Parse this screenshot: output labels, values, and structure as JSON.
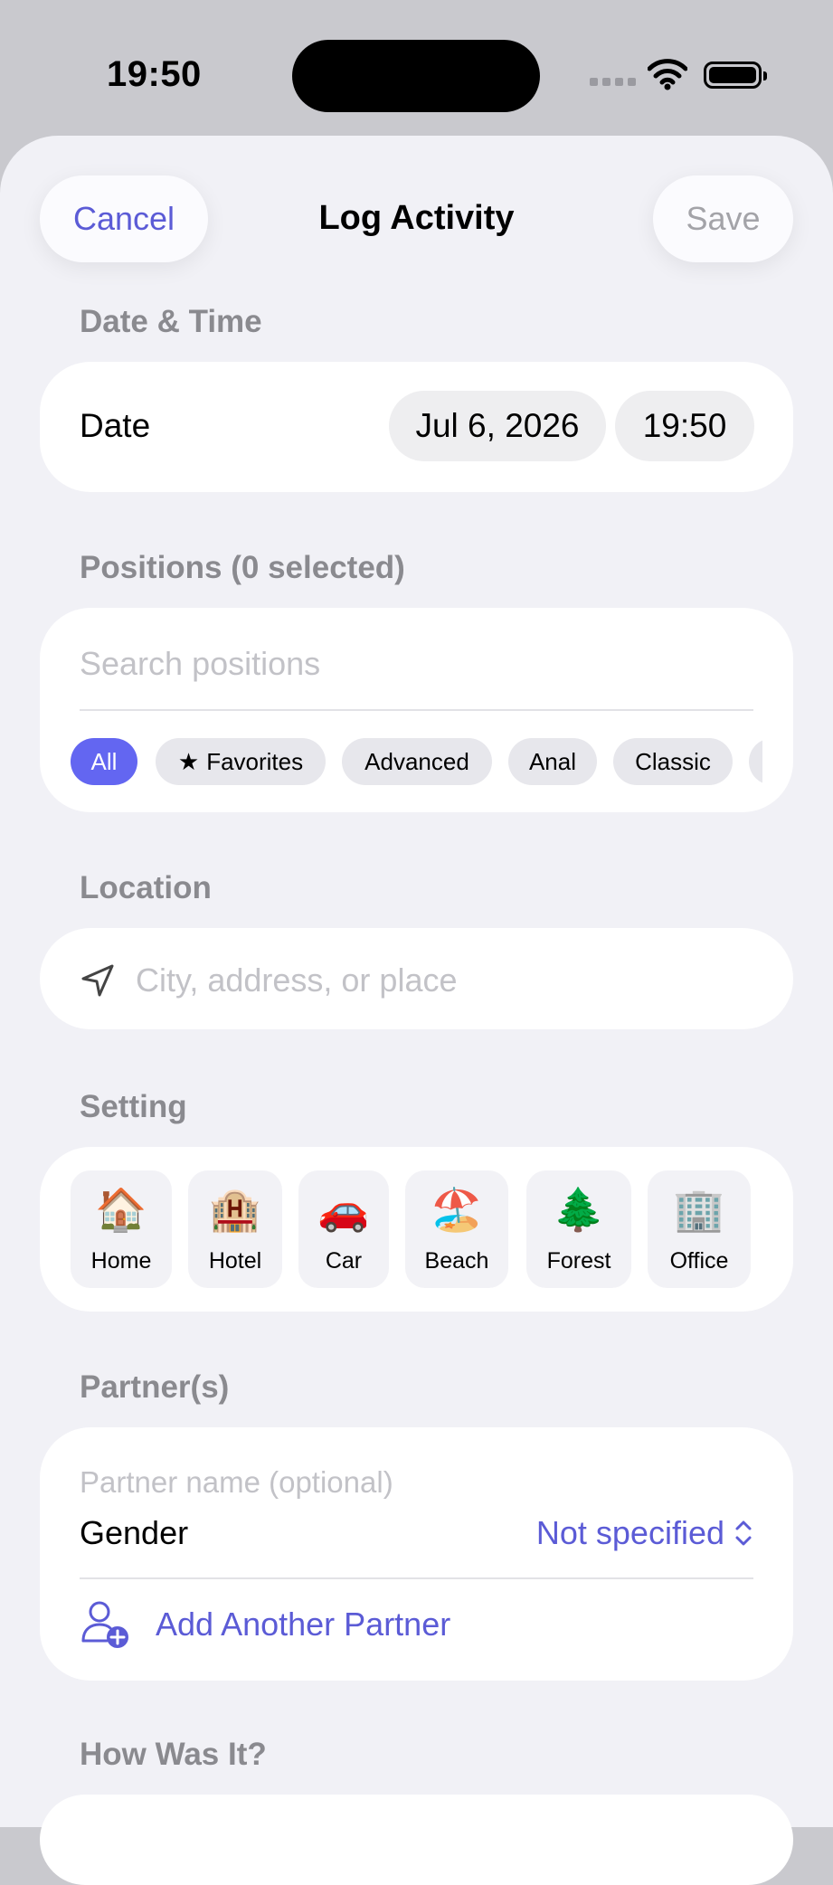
{
  "status_bar": {
    "time": "19:50"
  },
  "nav": {
    "cancel": "Cancel",
    "title": "Log Activity",
    "save": "Save"
  },
  "date_time": {
    "header": "Date & Time",
    "label": "Date",
    "date": "Jul 6, 2026",
    "time": "19:50"
  },
  "positions": {
    "header": "Positions (0 selected)",
    "search_placeholder": "Search positions",
    "chips": [
      {
        "label": "All",
        "active": true
      },
      {
        "label": "Favorites",
        "icon": "star-icon"
      },
      {
        "label": "Advanced"
      },
      {
        "label": "Anal"
      },
      {
        "label": "Classic"
      }
    ]
  },
  "location": {
    "header": "Location",
    "placeholder": "City, address, or place",
    "icon": "location-arrow-icon"
  },
  "setting": {
    "header": "Setting",
    "items": [
      {
        "emoji": "🏠",
        "label": "Home"
      },
      {
        "emoji": "🏨",
        "label": "Hotel"
      },
      {
        "emoji": "🚗",
        "label": "Car"
      },
      {
        "emoji": "🏖️",
        "label": "Beach"
      },
      {
        "emoji": "🌲",
        "label": "Forest"
      },
      {
        "emoji": "🏢",
        "label": "Office"
      }
    ]
  },
  "partners": {
    "header": "Partner(s)",
    "name_placeholder": "Partner name (optional)",
    "gender_label": "Gender",
    "gender_value": "Not specified",
    "add_label": "Add Another Partner"
  },
  "how_was_it": {
    "header": "How Was It?"
  },
  "colors": {
    "accent": "#6366f1",
    "link": "#5b5bd6",
    "background": "#f1f1f6"
  }
}
